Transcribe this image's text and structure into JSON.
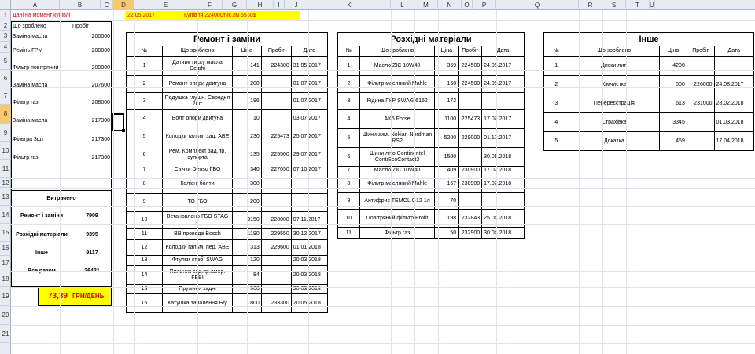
{
  "columns": [
    "A",
    "B",
    "C",
    "D",
    "E",
    "F",
    "G",
    "H",
    "I",
    "J",
    "K",
    "L",
    "M",
    "N",
    "O",
    "P",
    "Q",
    "R",
    "S",
    "T",
    "U"
  ],
  "selected_column": "D",
  "rows": [
    "1",
    "2",
    "3",
    "4",
    "5",
    "6",
    "7",
    "8",
    "9",
    "10",
    "11",
    "12",
    "13",
    "14",
    "15",
    "16",
    "17",
    "18",
    "19",
    "20",
    "21"
  ],
  "selected_row": "8",
  "header": {
    "purchase_label": "Дані на момент купівлі",
    "date": "22.05.2017",
    "purchase_info": "Купівля 224000тис.км 5550$"
  },
  "purchase_table": {
    "headers": [
      "Що зроблено",
      "Пробіг"
    ],
    "rows": [
      [
        "Заміна масла",
        "200000"
      ],
      [
        "Ремінь ГРМ",
        "200000"
      ],
      [
        "Фільтр повітряний",
        "200000"
      ],
      [
        "Заміна масла",
        "207600"
      ],
      [
        "Фільтр газ",
        "208000"
      ],
      [
        "Заміна масла",
        "217300"
      ],
      [
        "Фільтра 3шт",
        "217300"
      ],
      [
        "Фільтр газ",
        "217300"
      ]
    ]
  },
  "summary": {
    "title": "Витрачено",
    "rows": [
      [
        "Ремонт і заміни",
        "7909"
      ],
      [
        "Розхідні матеріали",
        "9395"
      ],
      [
        "Інше",
        "9117"
      ],
      [
        "Все разом",
        "26421"
      ]
    ],
    "per_day_value": "73,39",
    "per_day_unit": "ГРН/ДЕНЬ"
  },
  "repairs": {
    "title": "Ремонт і заміни",
    "headers": [
      "№",
      "Що зроблено",
      "Ціна",
      "Пробіг",
      "Дата"
    ],
    "rows": [
      [
        "1",
        "Датчик тиску масла Delphi",
        "141",
        "224300",
        "31.05.2017"
      ],
      [
        "2",
        "Ремонт опори двигуна",
        "200",
        "",
        "01.07.2017"
      ],
      [
        "3",
        "Подушка глушн. Середня 2шт",
        "196",
        "",
        "01.07.2017"
      ],
      [
        "4",
        "Болт опори двигуна",
        "10",
        "",
        "03.07.2017"
      ],
      [
        "5",
        "Колодки гальм. зад. ABE",
        "230",
        "225473",
        "25.07.2017"
      ],
      [
        "6",
        "Рем. Комплект зад.пр. супорта",
        "135",
        "225500",
        "29.07.2017"
      ],
      [
        "7",
        "Свічки Denso ГБО",
        "340",
        "227050",
        "07.10.2017"
      ],
      [
        "8",
        "Колісні болти",
        "300",
        "",
        ""
      ],
      [
        "9",
        "ТО ГБО",
        "200",
        "",
        ""
      ],
      [
        "10",
        "Встановлено ГБО STAG 4",
        "3150",
        "228000",
        "07.11.2017"
      ],
      [
        "11",
        "ВВ провода Bosch",
        "1190",
        "229550",
        "30.12.2017"
      ],
      [
        "12",
        "Колодки гальм. пер. ABE",
        "313",
        "229600",
        "01.01.2018"
      ],
      [
        "13",
        "Фтулки стаб. SWAG",
        "120",
        "",
        "20.03.2018"
      ],
      [
        "14",
        "Пильник зад.пр.амор. FEBI",
        "84",
        "",
        "20.03.2018"
      ],
      [
        "15",
        "Пружини задні",
        "500",
        "",
        "20.03.2018"
      ],
      [
        "16",
        "Катушка запалення Б/у",
        "800",
        "233300",
        "20.05.2018"
      ]
    ]
  },
  "consumables": {
    "title": "Розхідні матеріали",
    "headers": [
      "№",
      "Що зроблено",
      "Ціна",
      "Пробіг",
      "Дата"
    ],
    "rows": [
      [
        "1",
        "Масло ZIC 10W40",
        "369",
        "224500",
        "24.06.2017"
      ],
      [
        "2",
        "Фільтр масляний Mahle",
        "160",
        "224500",
        "24.06.2017"
      ],
      [
        "3",
        "Рідина ГУР SWAG 6162",
        "172",
        "",
        ""
      ],
      [
        "4",
        "AK6 Forse",
        "1100",
        "225473",
        "17.07.2017"
      ],
      [
        "5",
        "Шини зим. Nokian Nordman RS2",
        "5200",
        "229000",
        "01.12.2017"
      ],
      [
        "6",
        "Шини літо Continentel ContiEcoContact3",
        "1500",
        "",
        "30.01.2018"
      ],
      [
        "7",
        "Масло ZIC 10W40",
        "409",
        "230900",
        "17.02.2018"
      ],
      [
        "8",
        "Фільтр масляний Mahle",
        "167",
        "230900",
        "17.02.2018"
      ],
      [
        "9",
        "Антифриз TEMOL G12 1л",
        "70",
        "",
        ""
      ],
      [
        "10",
        "Повітряний фільтр Profit",
        "198",
        "232843",
        "25.04.2018"
      ],
      [
        "11",
        "Фільтр газ",
        "50",
        "232900",
        "30.04.2018"
      ]
    ]
  },
  "other": {
    "title": "Інше",
    "headers": [
      "№",
      "Що зроблено",
      "Ціна",
      "Пробіг",
      "Дата"
    ],
    "rows": [
      [
        "1",
        "Диски лит.",
        "4200",
        "",
        ""
      ],
      [
        "2",
        "Хімчистка",
        "500",
        "226000",
        "24.08.2017"
      ],
      [
        "3",
        "Перереєстрація",
        "613",
        "231000",
        "28.02.2018"
      ],
      [
        "4",
        "Страхівка",
        "3345",
        "",
        "01.03.2018"
      ],
      [
        "5",
        "Докатка",
        "459",
        "",
        "17.04.2018"
      ]
    ]
  }
}
